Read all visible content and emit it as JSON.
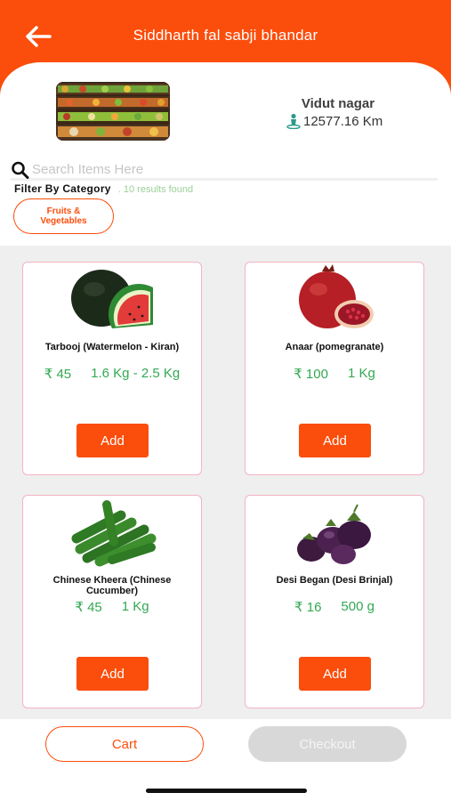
{
  "header": {
    "title": "Siddharth fal sabji bhandar",
    "back_icon": "arrow-left-icon"
  },
  "store": {
    "name": "Vidut nagar",
    "distance": "12577.16 Km",
    "location_icon": "person-pin-icon"
  },
  "search": {
    "placeholder": "Search Items Here",
    "value": ""
  },
  "filter": {
    "label": "Filter By Category",
    "results": ". 10 results found",
    "chips": [
      {
        "label": "Fruits &\nVegetables"
      }
    ]
  },
  "products": [
    {
      "name": "Tarbooj (Watermelon - Kiran)",
      "price": "₹ 45",
      "qty": "1.6 Kg - 2.5 Kg",
      "add_label": "Add"
    },
    {
      "name": "Anaar (pomegranate)",
      "price": "₹ 100",
      "qty": "1 Kg",
      "add_label": "Add"
    },
    {
      "name": "Chinese Kheera (Chinese Cucumber)",
      "price": "₹ 45",
      "qty": "1 Kg",
      "add_label": "Add"
    },
    {
      "name": "Desi Began (Desi Brinjal)",
      "price": "₹ 16",
      "qty": "500 g",
      "add_label": "Add"
    }
  ],
  "footer": {
    "cart_label": "Cart",
    "checkout_label": "Checkout"
  },
  "colors": {
    "accent": "#fb4d0b",
    "price": "#33a852",
    "card_border": "#f4b3c1",
    "grid_bg": "#efefef"
  }
}
